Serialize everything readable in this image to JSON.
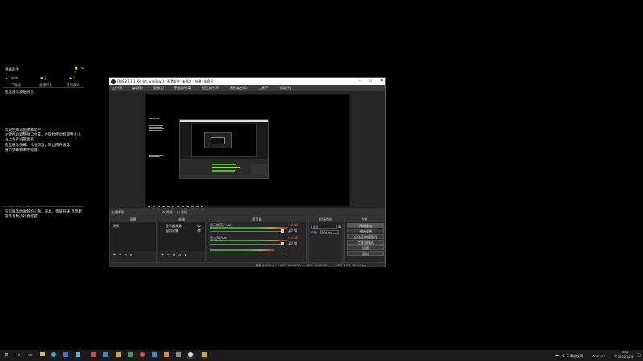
{
  "left_panel": {
    "title": "弹幕助手",
    "controls": [
      "🔒",
      "⚙",
      "✕"
    ],
    "stats": [
      {
        "icon": "♦",
        "value": "14808"
      },
      {
        "icon": "♥",
        "value": "31"
      },
      {
        "icon": "✚",
        "value": "1"
      }
    ],
    "tabs": [
      "气氛值",
      "直播时长",
      "在线观众"
    ],
    "messages": [
      "这里展示发送消息",
      "欢迎使用斗鱼弹幕助手\n左键拖动调整窗口位置，左键拉伸边框调整大小\n右上角有设置面板\n这里展示弹幕、礼物消息，粉丝牌升级等\n展示弹幕和事件提醒",
      "这里展示你收到的礼物、道具、贵族开通\n点赞超管等总数小礼物提醒"
    ]
  },
  "obs": {
    "title": "OBS 27.1.3 (64 bit, windows) - 配置文件: 未命名 - 场景: 未命名",
    "menu": [
      "文件(F)",
      "编辑(E)",
      "视图(V)",
      "停靠部件(D)",
      "配置文件(P)",
      "场景集合(S)",
      "工具(T)",
      "帮助(H)"
    ],
    "midstrip": {
      "no_source": "未选择源",
      "properties": "⚙ 属性",
      "filters": "◫ 滤镜"
    },
    "docks": {
      "scenes": {
        "header": "场景",
        "items": [
          "场景"
        ]
      },
      "sources": {
        "header": "来源",
        "items": [
          "显示器采集",
          "窗口采集"
        ]
      },
      "mixer": {
        "header": "混音器",
        "tracks": [
          {
            "name": "显示捕获 / Aux",
            "db": "0.0 dB"
          },
          {
            "name": "麦克风/Aux",
            "db": "0.0 dB"
          },
          {
            "name": "桌面音频",
            "db": "0.0 dB"
          }
        ]
      },
      "transitions": {
        "header": "转场特效",
        "type_label": "淡出",
        "duration_label": "时长",
        "duration_value": "300 ms"
      },
      "controls": {
        "header": "控件",
        "buttons": [
          "开始推流",
          "开始录制",
          "启动虚拟摄像机",
          "工作室模式",
          "设置",
          "退出"
        ]
      }
    },
    "statusbar": {
      "dropped": "丢帧 0 (0.0%)",
      "live": "LIVE: 00:00:00",
      "rec": "REC: 00:00:00",
      "cpu": "CPU: 1.1%, 30.00 fps"
    }
  },
  "taskbar": {
    "weather": "-1°C 晴朗夜间",
    "time": "0:32",
    "date": "2022/1/23",
    "lang": "中"
  },
  "colors": {
    "obs_bg": "#2b2b2b",
    "accent_green": "#33aa33",
    "meter_red": "#ff5555"
  }
}
